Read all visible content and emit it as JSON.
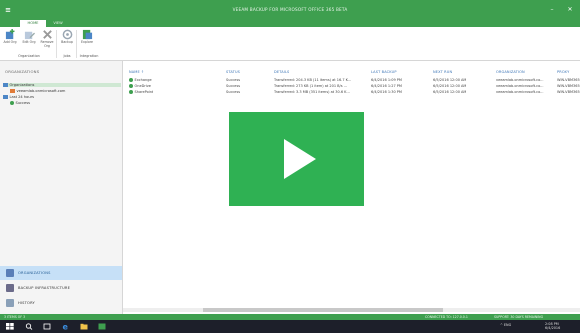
{
  "window": {
    "title": "VEEAM BACKUP FOR MICROSOFT OFFICE 365 BETA",
    "app_menu_glyph": "≡",
    "minimize_glyph": "–",
    "close_glyph": "✕"
  },
  "ribbon_tabs": [
    {
      "label": "HOME",
      "active": true
    },
    {
      "label": "VIEW",
      "active": false
    }
  ],
  "ribbon": {
    "buttons": [
      {
        "label": "Add Org",
        "icon": "add-org-icon"
      },
      {
        "label": "Edit Org",
        "icon": "edit-org-icon"
      },
      {
        "label": "Remove Org",
        "icon": "remove-org-icon"
      },
      {
        "label": "Backup",
        "icon": "backup-icon"
      },
      {
        "label": "Explore",
        "icon": "explore-icon"
      }
    ],
    "groups": [
      "Organization",
      "Jobs",
      "Integration"
    ]
  },
  "left_pane": {
    "header": "ORGANIZATIONS",
    "tree": [
      {
        "label": "Organizations",
        "level": 0,
        "selected": true
      },
      {
        "label": "veeamlab.onmicrosoft.com",
        "level": 1,
        "selected": false
      },
      {
        "label": "Last 24 hours",
        "level": 0,
        "selected": false
      },
      {
        "label": "Success",
        "level": 1,
        "selected": false
      }
    ],
    "nav": [
      {
        "label": "ORGANIZATIONS",
        "active": true
      },
      {
        "label": "BACKUP INFRASTRUCTURE",
        "active": false
      },
      {
        "label": "HISTORY",
        "active": false
      }
    ]
  },
  "grid": {
    "columns": [
      "NAME ↑",
      "STATUS",
      "DETAILS",
      "LAST BACKUP",
      "NEXT RUN",
      "ORGANIZATION",
      "PROXY"
    ],
    "rows": [
      {
        "name": "Exchange",
        "status": "Success",
        "details": "Transferred: 204.3 KB (11 items) at 16.7 K...",
        "last_backup": "6/4/2016 1:09 PM",
        "next_run": "6/5/2016 12:00 AM",
        "organization": "veeamlab.onmicrosoft.co...",
        "proxy": "WIN-VBM365"
      },
      {
        "name": "OneDrive",
        "status": "Success",
        "details": "Transferred: 273 KB (1 item) at 201 B/s ...",
        "last_backup": "6/4/2016 1:27 PM",
        "next_run": "6/5/2016 12:00 AM",
        "organization": "veeamlab.onmicrosoft.co...",
        "proxy": "WIN-VBM365"
      },
      {
        "name": "SharePoint",
        "status": "Success",
        "details": "Transferred: 3.3 MB (351 items) at 30.6 K...",
        "last_backup": "6/4/2016 1:30 PM",
        "next_run": "6/5/2016 12:00 AM",
        "organization": "veeamlab.onmicrosoft.co...",
        "proxy": "WIN-VBM365"
      }
    ]
  },
  "status_bar": {
    "left": "3 ITEMS OF 3",
    "connection": "CONNECTED TO: 127.0.0.1",
    "support": "SUPPORT: 30 DAYS REMAINING"
  },
  "taskbar": {
    "tray_text": "^  ENG",
    "time": "2:08 PM",
    "date": "6/4/2016"
  },
  "colors": {
    "brand_green": "#3e9f4f",
    "play_overlay": "#2fb153",
    "link_blue": "#3a73b5"
  }
}
